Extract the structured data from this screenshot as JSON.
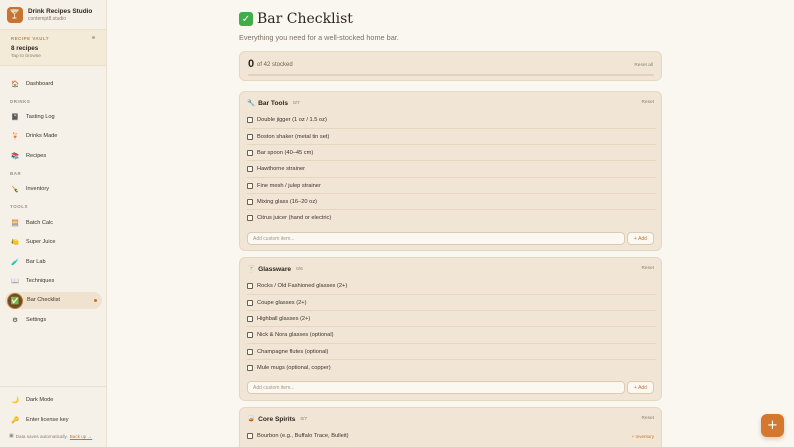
{
  "app": {
    "name": "Drink Recipes Studio",
    "subtitle": "contempt8.studio"
  },
  "vault": {
    "label": "RECIPE VAULT",
    "count": "8 recipes",
    "hint": "Tap to browse"
  },
  "nav": {
    "dashboard": {
      "label": "Dashboard",
      "icon": "🏠"
    },
    "section_drinks": "DRINKS",
    "tasting_log": {
      "label": "Tasting Log",
      "icon": "📓"
    },
    "drinks_made": {
      "label": "Drinks Made",
      "icon": "🍹"
    },
    "recipes": {
      "label": "Recipes",
      "icon": "📚"
    },
    "section_bar": "BAR",
    "inventory": {
      "label": "Inventory",
      "icon": "🍾"
    },
    "section_tools": "TOOLS",
    "batch_calc": {
      "label": "Batch Calc",
      "icon": "🧮"
    },
    "super_juice": {
      "label": "Super Juice",
      "icon": "🍋"
    },
    "bar_lab": {
      "label": "Bar Lab",
      "icon": "🧪"
    },
    "techniques": {
      "label": "Techniques",
      "icon": "📖"
    },
    "bar_checklist": {
      "label": "Bar Checklist",
      "icon": "✅"
    },
    "settings": {
      "label": "Settings",
      "icon": "⚙"
    },
    "dark_mode": {
      "label": "Dark Mode",
      "icon": "🌙"
    },
    "license": {
      "label": "Enter license key",
      "icon": "🔑"
    }
  },
  "footer": {
    "saved_text": "Data saves automatically.",
    "backup_link": "Back up →"
  },
  "page": {
    "title": "Bar Checklist",
    "subtitle": "Everything you need for a well-stocked home bar."
  },
  "progress": {
    "stocked": "0",
    "of_text": "of 42 stocked",
    "reset_all": "Reset all",
    "fraction": 0
  },
  "sections": {
    "bar_tools": {
      "icon": "🔧",
      "title": "Bar Tools",
      "count": "0/7",
      "reset": "Reset",
      "items": [
        "Double jigger (1 oz / 1.5 oz)",
        "Boston shaker (metal tin set)",
        "Bar spoon (40–45 cm)",
        "Hawthorne strainer",
        "Fine mesh / julep strainer",
        "Mixing glass (16–20 oz)",
        "Citrus juicer (hand or electric)"
      ],
      "add_placeholder": "Add custom item...",
      "add_label": "+ Add"
    },
    "glassware": {
      "icon": "🍸",
      "title": "Glassware",
      "count": "0/6",
      "reset": "Reset",
      "items": [
        "Rocks / Old Fashioned glasses (2+)",
        "Coupe glasses (2+)",
        "Highball glasses (2+)",
        "Nick & Nora glasses (optional)",
        "Champagne flutes (optional)",
        "Mule mugs (optional, copper)"
      ],
      "add_placeholder": "Add custom item...",
      "add_label": "+ Add"
    },
    "core_spirits": {
      "icon": "🥃",
      "title": "Core Spirits",
      "count": "0/7",
      "reset": "Reset",
      "items": [
        "Bourbon (e.g., Buffalo Trace, Bulleit)"
      ],
      "tag": "+ Inventory"
    }
  },
  "fab": {
    "label": "+"
  },
  "colors": {
    "accent": "#c8742f",
    "card": "#f1e6d6",
    "sidebar": "#f6f1e8",
    "check_green": "#3fae49"
  }
}
